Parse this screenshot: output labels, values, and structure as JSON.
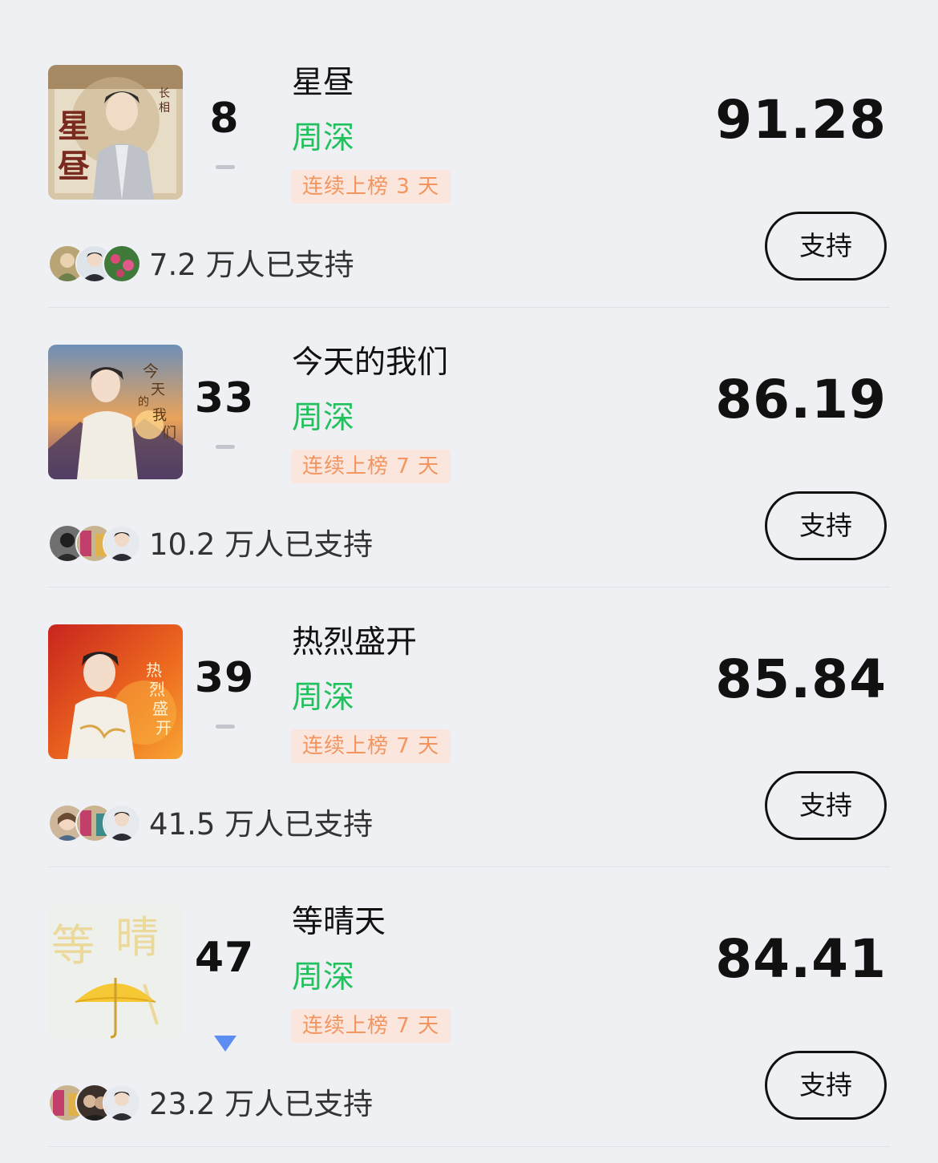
{
  "colors": {
    "background": "#eef0f4",
    "artist_green": "#22c15e",
    "streak_bg": "#fbe6dd",
    "streak_text": "#f2955f",
    "trend_down": "#5b8ef0",
    "trend_flat": "#c2c5cb"
  },
  "entries": [
    {
      "rank": "8",
      "trend": "flat",
      "title": "星昼",
      "artist": "周深",
      "streak": "连续上榜 3 天",
      "score": "91.28",
      "supporters": "7.2 万人已支持",
      "button": "支持",
      "cover_icon": "album-cover-xingzhou"
    },
    {
      "rank": "33",
      "trend": "flat",
      "title": "今天的我们",
      "artist": "周深",
      "streak": "连续上榜 7 天",
      "score": "86.19",
      "supporters": "10.2 万人已支持",
      "button": "支持",
      "cover_icon": "album-cover-jintiandewomen"
    },
    {
      "rank": "39",
      "trend": "flat",
      "title": "热烈盛开",
      "artist": "周深",
      "streak": "连续上榜 7 天",
      "score": "85.84",
      "supporters": "41.5 万人已支持",
      "button": "支持",
      "cover_icon": "album-cover-relieshengkai"
    },
    {
      "rank": "47",
      "trend": "down",
      "title": "等晴天",
      "artist": "周深",
      "streak": "连续上榜 7 天",
      "score": "84.41",
      "supporters": "23.2 万人已支持",
      "button": "支持",
      "cover_icon": "album-cover-dengqingtian"
    }
  ]
}
